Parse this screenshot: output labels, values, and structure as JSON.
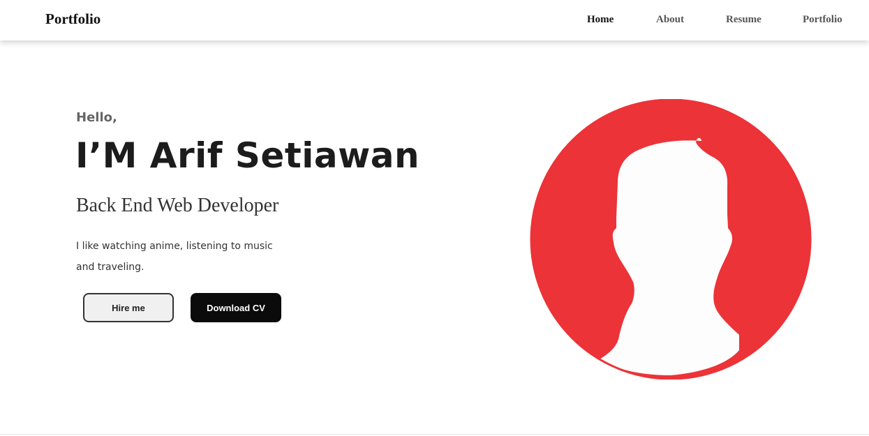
{
  "nav": {
    "brand": "Portfolio",
    "items": [
      {
        "label": "Home",
        "active": true
      },
      {
        "label": "About",
        "active": false
      },
      {
        "label": "Resume",
        "active": false
      },
      {
        "label": "Portfolio",
        "active": false
      }
    ]
  },
  "hero": {
    "greeting": "Hello,",
    "name": "I’M Arif Setiawan",
    "role": "Back End Web Developer",
    "bio_line1": "I like watching anime, listening to music",
    "bio_line2": "and traveling.",
    "hire_label": "Hire me",
    "cv_label": "Download CV"
  },
  "avatar": {
    "icon": "user-silhouette-icon",
    "color": "#ec3338"
  }
}
